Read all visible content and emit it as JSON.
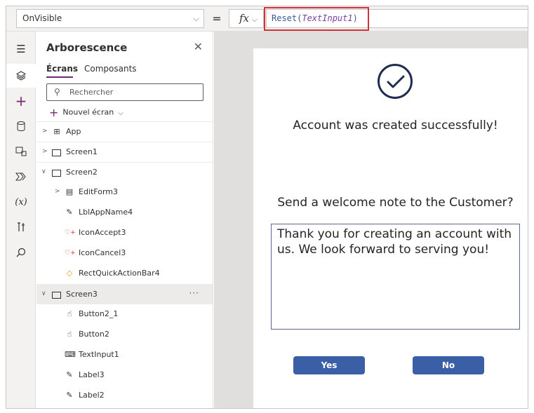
{
  "formula_bar": {
    "property": "OnVisible",
    "equals": "=",
    "fx": "fx",
    "formula_fn": "Reset(",
    "formula_arg": "TextInput1",
    "formula_close": ")"
  },
  "tree": {
    "title": "Arborescence",
    "tabs": [
      "Écrans",
      "Composants"
    ],
    "search_placeholder": "Rechercher",
    "new_screen": "Nouvel écran",
    "items": [
      {
        "label": "App"
      },
      {
        "label": "Screen1"
      },
      {
        "label": "Screen2"
      },
      {
        "label": "EditForm3"
      },
      {
        "label": "LblAppName4"
      },
      {
        "label": "IconAccept3"
      },
      {
        "label": "IconCancel3"
      },
      {
        "label": "RectQuickActionBar4"
      },
      {
        "label": "Screen3"
      },
      {
        "label": "Button2_1"
      },
      {
        "label": "Button2"
      },
      {
        "label": "TextInput1"
      },
      {
        "label": "Label3"
      },
      {
        "label": "Label2"
      }
    ]
  },
  "canvas": {
    "success_text": "Account was created successfully!",
    "question_text": "Send a welcome note to the Customer?",
    "note_text": "Thank you for creating an account with us. We look forward to serving you!",
    "yes_label": "Yes",
    "no_label": "No"
  },
  "colors": {
    "accent": "#742774",
    "button": "#3a5fa6",
    "highlight": "#d13438"
  }
}
